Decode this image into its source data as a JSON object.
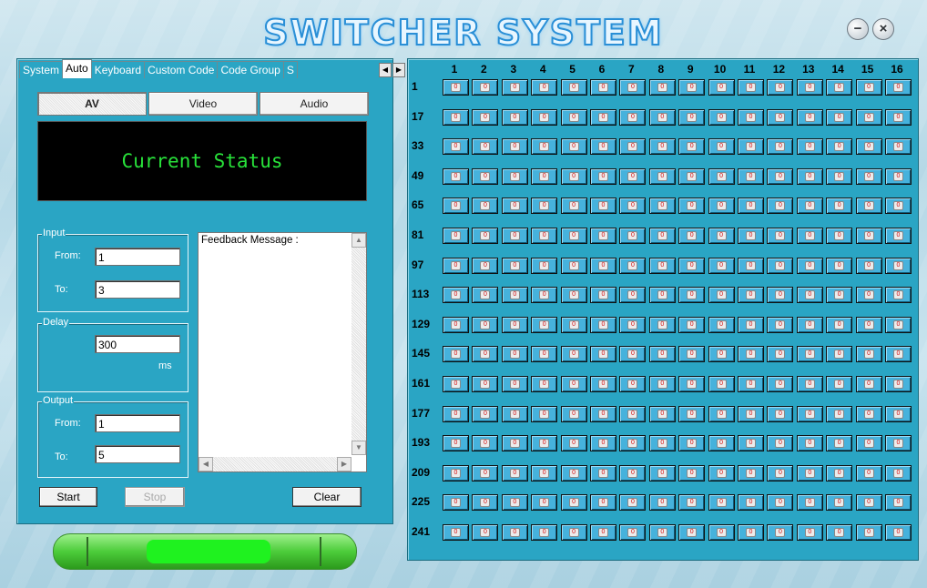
{
  "window": {
    "title": "SWITCHER SYSTEM",
    "minimize_icon": "minimize-icon",
    "close_icon": "close-icon"
  },
  "tabs": [
    {
      "label": "System",
      "active": false
    },
    {
      "label": "Auto",
      "active": true
    },
    {
      "label": "Keyboard",
      "active": false
    },
    {
      "label": "Custom Code",
      "active": false
    },
    {
      "label": "Code Group",
      "active": false
    },
    {
      "label": "S",
      "active": false
    }
  ],
  "mode": {
    "av": "AV",
    "video": "Video",
    "audio": "Audio",
    "selected": "AV"
  },
  "status_text": "Current Status",
  "input": {
    "group_label": "Input",
    "from_label": "From:",
    "from_value": "1",
    "to_label": "To:",
    "to_value": "3"
  },
  "delay": {
    "group_label": "Delay",
    "value": "300",
    "unit": "ms"
  },
  "output": {
    "group_label": "Output",
    "from_label": "From:",
    "from_value": "1",
    "to_label": "To:",
    "to_value": "5"
  },
  "feedback": {
    "title": "Feedback Message :"
  },
  "buttons": {
    "start": "Start",
    "stop": "Stop",
    "clear": "Clear"
  },
  "matrix": {
    "columns": [
      "1",
      "2",
      "3",
      "4",
      "5",
      "6",
      "7",
      "8",
      "9",
      "10",
      "11",
      "12",
      "13",
      "14",
      "15",
      "16"
    ],
    "rows": [
      "1",
      "17",
      "33",
      "49",
      "65",
      "81",
      "97",
      "113",
      "129",
      "145",
      "161",
      "177",
      "193",
      "209",
      "225",
      "241"
    ],
    "cell_value": "0",
    "colors": {
      "panel": "#2aa5c4",
      "indicator": "#d41010"
    }
  }
}
